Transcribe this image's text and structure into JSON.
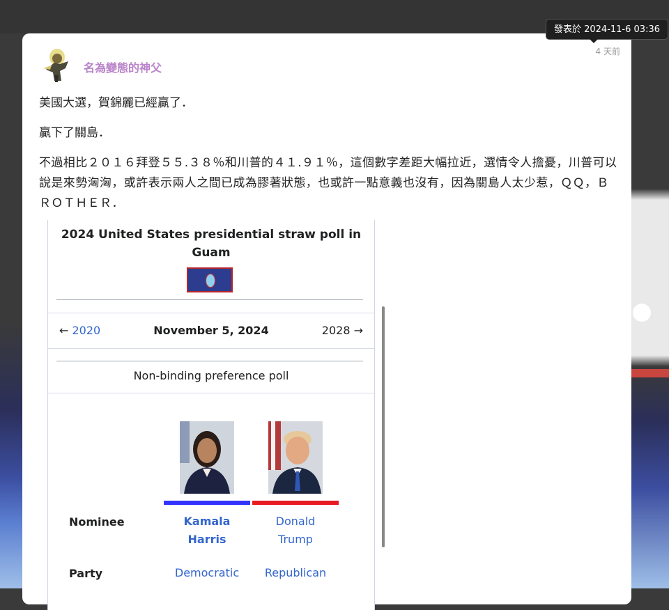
{
  "tooltip": {
    "text": "發表於 2024-11-6 03:36"
  },
  "post": {
    "author": "名為變態的神父",
    "time_ago": "4 天前",
    "paragraphs": [
      "美國大選，賀錦麗已經贏了．",
      "贏下了關島．",
      "不過相比２０１６拜登５５.３８％和川普的４１.９１％，這個數字差距大幅拉近，選情令人擔憂，川普可以說是來勢洶洶，或許表示兩人之間已成為膠著狀態，也或許一點意義也沒有，因為關島人太少惹，ＱＱ，ＢＲＯＴＨＥＲ．"
    ]
  },
  "infobox": {
    "title": "2024 United States presidential straw poll in Guam",
    "prev": "2020",
    "prev_arrow": "←",
    "date": "November 5, 2024",
    "next": "2028",
    "next_arrow": "→",
    "poll_type": "Non-binding preference poll",
    "rows": {
      "nominee_label": "Nominee",
      "party_label": "Party"
    },
    "candidates": [
      {
        "name_line1": "Kamala",
        "name_line2": "Harris",
        "party": "Democratic",
        "color": "#3333ff"
      },
      {
        "name_line1": "Donald",
        "name_line2": "Trump",
        "party": "Republican",
        "color": "#e81b23"
      }
    ]
  },
  "colors": {
    "author": "#b983c9",
    "link": "#3366cc",
    "democratic": "#3333ff",
    "republican": "#e81b23"
  }
}
